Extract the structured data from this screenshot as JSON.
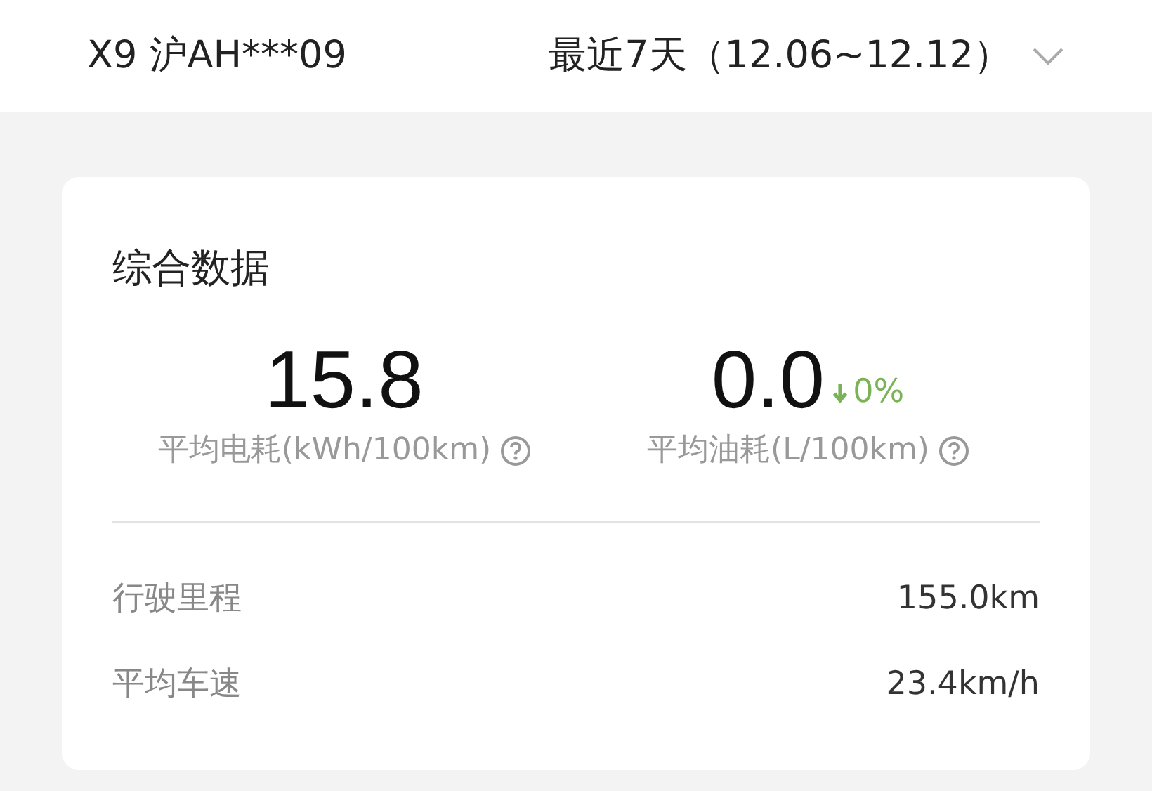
{
  "header": {
    "vehicle": "X9 沪AH***09",
    "period": "最近7天（12.06~12.12）"
  },
  "summary": {
    "title": "综合数据",
    "metrics": [
      {
        "value": "15.8",
        "label": "平均电耗(kWh/100km)"
      },
      {
        "value": "0.0",
        "label": "平均油耗(L/100km)",
        "change": {
          "kind": "decrease",
          "text": "0%"
        }
      }
    ],
    "rows": [
      {
        "label": "行驶里程",
        "value": "155.0km"
      },
      {
        "label": "平均车速",
        "value": "23.4km/h"
      }
    ]
  }
}
